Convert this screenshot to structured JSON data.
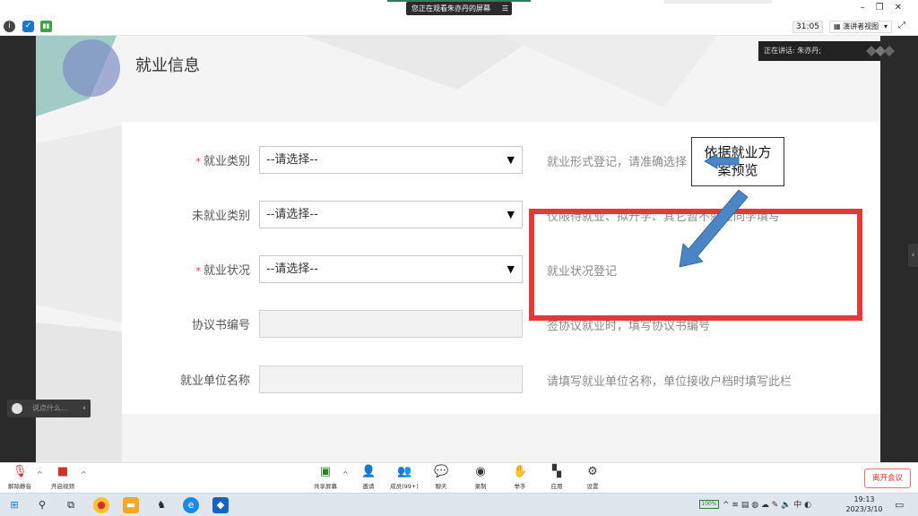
{
  "window": {
    "share_banner": "您正在观看朱亦丹的屏幕",
    "share_menu_icon": "menu-icon",
    "minimize": "–",
    "restore": "❐",
    "close": "✕"
  },
  "status": {
    "timer": "31:05",
    "view_mode": "演讲者视图",
    "view_caret": "▾",
    "fullscreen": "⤢"
  },
  "speaker": {
    "label": "正在讲话: 朱亦丹;"
  },
  "page": {
    "title": "就业信息",
    "form": [
      {
        "label": "就业类别",
        "required": true,
        "type": "select",
        "value": "--请选择--",
        "hint": "就业形式登记，请准确选择"
      },
      {
        "label": "未就业类别",
        "required": false,
        "type": "select",
        "value": "--请选择--",
        "hint": "仅限待就业、拟升学、其它暂不就业同学填写"
      },
      {
        "label": "就业状况",
        "required": true,
        "type": "select",
        "value": "--请选择--",
        "hint": "就业状况登记"
      },
      {
        "label": "协议书编号",
        "required": false,
        "type": "input",
        "value": "",
        "hint": "签协议就业时，填写协议书编号"
      },
      {
        "label": "就业单位名称",
        "required": false,
        "type": "input",
        "value": "",
        "hint": "请填写就业单位名称，单位接收户档时填写此栏"
      }
    ],
    "required_mark": "*",
    "select_caret": "▼",
    "callout": {
      "line1": "依据就业方",
      "line2": "案预览"
    },
    "annotation_color": "#e53935",
    "arrow_color": "#4a86c5"
  },
  "chat": {
    "placeholder": "说点什么...",
    "collapse": "‹"
  },
  "toolbar": {
    "mute_label": "解除静音",
    "video_label": "开启视频",
    "share_label": "共享屏幕",
    "invite_label": "邀请",
    "members_label": "成员(99+)",
    "chat_label": "聊天",
    "record_label": "录制",
    "raise_label": "举手",
    "apps_label": "应用",
    "settings_label": "设置",
    "leave_label": "离开会议",
    "caret": "^"
  },
  "taskbar": {
    "battery": "100%",
    "ime": "中",
    "time": "19:13",
    "date": "2023/3/10"
  }
}
